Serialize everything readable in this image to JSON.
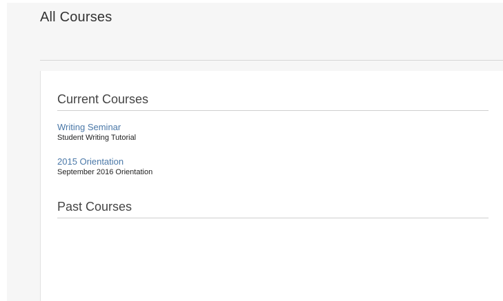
{
  "page": {
    "title": "All Courses"
  },
  "current_courses": {
    "heading": "Current Courses",
    "items": [
      {
        "name": "Writing Seminar",
        "description": "Student Writing Tutorial"
      },
      {
        "name": "2015 Orientation",
        "description": "September 2016 Orientation"
      }
    ]
  },
  "past_courses": {
    "heading": "Past Courses",
    "items": []
  },
  "colors": {
    "link": "#4a78a8",
    "background": "#f6f6f6",
    "card": "#ffffff",
    "rule": "#cfcfcf"
  }
}
